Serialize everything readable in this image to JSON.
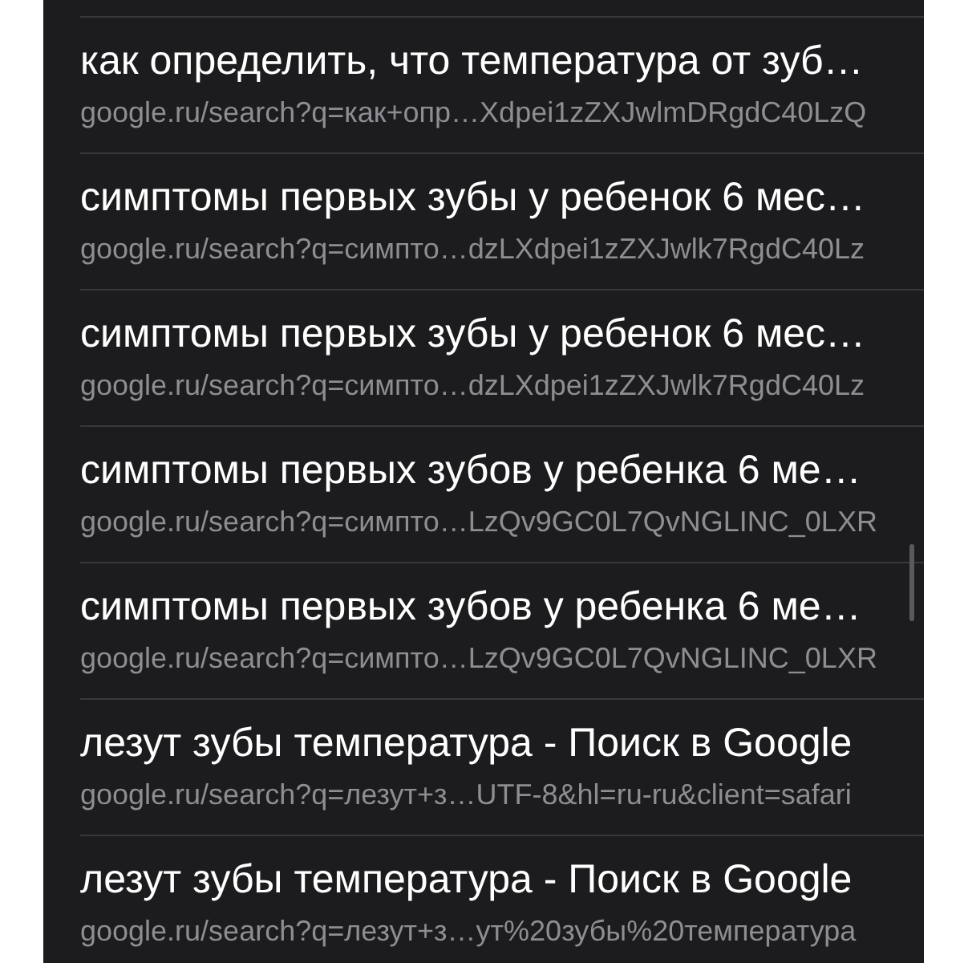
{
  "history": {
    "items": [
      {
        "title": "как определить, что температура от зуб…",
        "url": "google.ru/search?q=как+опр…Xdpei1zZXJwlmDRgdC40LzQ"
      },
      {
        "title": "симптомы первых зубы у ребенок 6 мес…",
        "url": "google.ru/search?q=симпто…dzLXdpei1zZXJwlk7RgdC40Lz"
      },
      {
        "title": "симптомы первых зубы у ребенок 6 мес…",
        "url": "google.ru/search?q=симпто…dzLXdpei1zZXJwlk7RgdC40Lz"
      },
      {
        "title": "симптомы первых зубов у ребенка 6 ме…",
        "url": "google.ru/search?q=симпто…LzQv9GC0L7QvNGLINC_0LXR"
      },
      {
        "title": "симптомы первых зубов у ребенка 6 ме…",
        "url": "google.ru/search?q=симпто…LzQv9GC0L7QvNGLINC_0LXR"
      },
      {
        "title": "лезут зубы температура - Поиск в Google",
        "url": "google.ru/search?q=лезут+з…UTF-8&hl=ru-ru&client=safari"
      },
      {
        "title": "лезут зубы температура - Поиск в Google",
        "url": "google.ru/search?q=лезут+з…ут%20зубы%20температура"
      }
    ]
  }
}
